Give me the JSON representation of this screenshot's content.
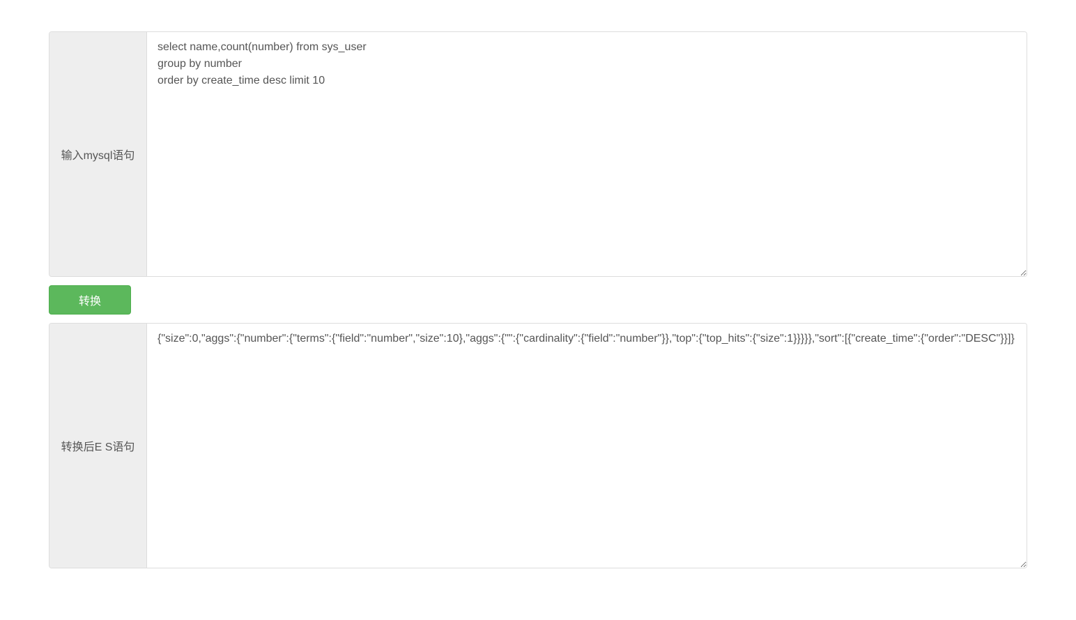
{
  "input": {
    "label": "输入mysql语句",
    "value": "select name,count(number) from sys_user\ngroup by number\norder by create_time desc limit 10"
  },
  "button": {
    "convert_label": "转换"
  },
  "output": {
    "label": "转换后E S语句",
    "value": "{\"size\":0,\"aggs\":{\"number\":{\"terms\":{\"field\":\"number\",\"size\":10},\"aggs\":{\"\":{\"cardinality\":{\"field\":\"number\"}},\"top\":{\"top_hits\":{\"size\":1}}}}},\"sort\":[{\"create_time\":{\"order\":\"DESC\"}}]}"
  }
}
